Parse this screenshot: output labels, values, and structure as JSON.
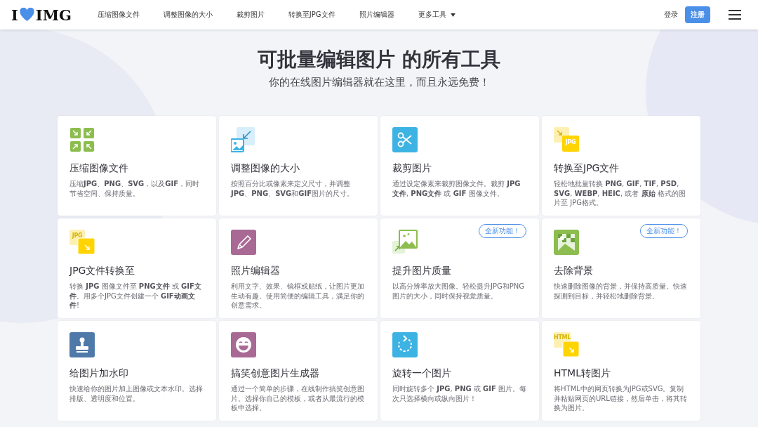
{
  "header": {
    "logo": {
      "left": "I",
      "right": "IMG"
    },
    "nav": [
      {
        "label": "压缩图像文件"
      },
      {
        "label": "调整图像的大小"
      },
      {
        "label": "裁剪图片"
      },
      {
        "label": "转换至JPG文件"
      },
      {
        "label": "照片编辑器"
      },
      {
        "label": "更多工具",
        "dropdown": true
      }
    ],
    "login": "登录",
    "signup": "注册"
  },
  "hero": {
    "title": "可批量编辑图片 的所有工具",
    "subtitle": "你的在线图片编辑器就在这里，而且永远免费！"
  },
  "tools": [
    {
      "kind": "compress",
      "title": "压缩图像文件",
      "description": "压缩**JPG**、**PNG**、**SVG**，以及**GIF**，同时节省空间、保持质量。"
    },
    {
      "kind": "resize",
      "title": "调整图像的大小",
      "description": "按照百分比或像素来定义尺寸，并调整**JPG**、**PNG**、**SVG**和**GIF**图片的尺寸。"
    },
    {
      "kind": "crop",
      "title": "裁剪图片",
      "description": "通过设定像素来裁剪图像文件。裁剪 **JPG文件**, **PNG文件** 或 **GIF** 图像文件。"
    },
    {
      "kind": "to-jpg",
      "icon_text": "JPG",
      "title": "转换至JPG文件",
      "description": "轻松地批量转换 **PNG**, **GIF**, **TIF**, **PSD**, **SVG**, **WEBP**, **HEIC**, 或者 **原始** 格式的图片至 JPG格式。"
    },
    {
      "kind": "from-jpg",
      "icon_text": "JPG",
      "title": "JPG文件转换至",
      "description": "转换 **JPG** 图像文件至 **PNG文件** 或 **GIF文件**。用多个JPG文件创建一个 **GIF动画文件**!"
    },
    {
      "kind": "edit",
      "title": "照片编辑器",
      "description": "利用文字、效果、镜框或贴纸，让图片更加生动有趣。使用简便的编辑工具，满足你的创意需求。"
    },
    {
      "kind": "upscale",
      "title": "提升图片质量",
      "description": "以高分辨率放大图像。轻松提升JPG和PNG图片的大小，同时保持视觉质量。",
      "badge": "全新功能！"
    },
    {
      "kind": "remove-bg",
      "title": "去除背景",
      "description": "快速删除图像的背景，并保持高质量。快速探测到目标，并轻松地删除背景。",
      "badge": "全新功能！"
    },
    {
      "kind": "watermark",
      "title": "给图片加水印",
      "description": "快速给你的图片加上图像或文本水印。选择排版、透明度和位置。"
    },
    {
      "kind": "meme",
      "title": "搞笑创意图片生成器",
      "description": "通过一个简单的步骤，在线制作搞笑创意图片。选择你自己的模板，或者从最流行的模板中选择。"
    },
    {
      "kind": "rotate",
      "title": "旋转一个图片",
      "description": "同时旋转多个 **JPG**, **PNG** 或 **GIF** 图片。每次只选择横向或纵向图片！"
    },
    {
      "kind": "html",
      "icon_text": "HTML",
      "title": "HTML转图片",
      "description": "将HTML中的网页转换为JPG或SVG。复制并粘贴网页的URL链接，然后单击，将其转换为图片。"
    }
  ]
}
